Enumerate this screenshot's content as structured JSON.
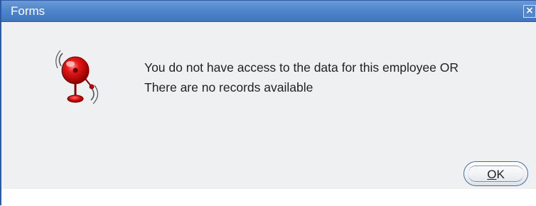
{
  "window": {
    "title": "Forms",
    "close_glyph": "×",
    "titlebar_color": "#4f86cc"
  },
  "dialog": {
    "icon": "alarm-bell-icon",
    "message_lines": [
      "You do not have access to the data for this employee OR",
      "There are no records available"
    ],
    "ok_button": {
      "mnemonic": "O",
      "rest": "K"
    }
  }
}
